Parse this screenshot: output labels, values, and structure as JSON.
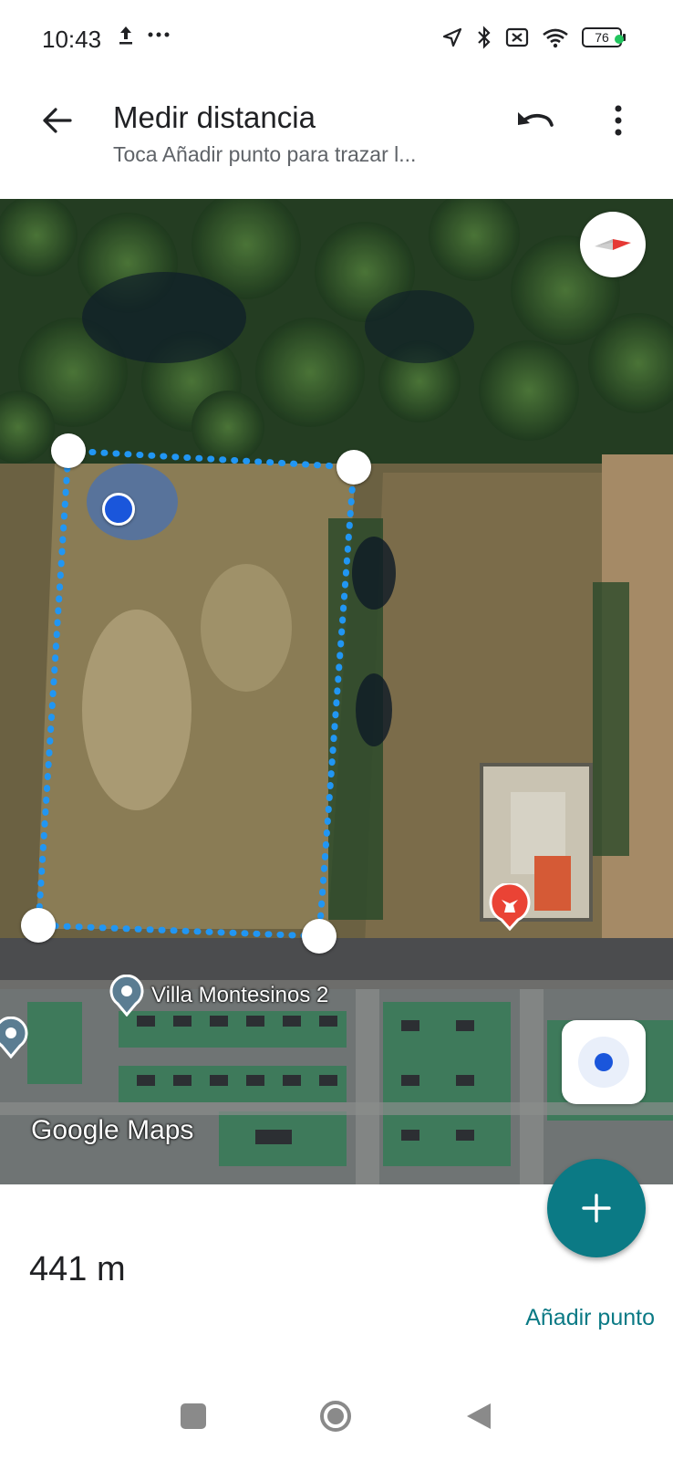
{
  "status_bar": {
    "time": "10:43",
    "battery": "76",
    "icons": [
      "upload-icon",
      "more-dots-icon",
      "location-arrow-icon",
      "bluetooth-icon",
      "no-sim-icon",
      "wifi-icon",
      "battery-icon"
    ]
  },
  "app_bar": {
    "title": "Medir distancia",
    "subtitle": "Toca Añadir punto para trazar l..."
  },
  "map": {
    "place_label": "Villa Montesinos 2",
    "watermark": "Google Maps",
    "route_color": "#2196f3"
  },
  "bottom": {
    "distance": "441 m",
    "add_point_label": "Añadir punto"
  },
  "colors": {
    "accent": "#0b7a85",
    "route": "#2196f3",
    "location_dot": "#1a56db"
  }
}
